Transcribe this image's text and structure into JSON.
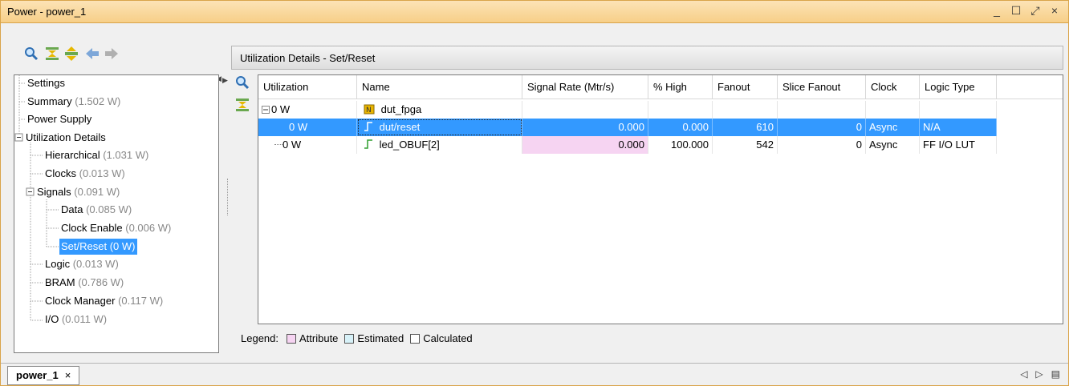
{
  "window": {
    "title": "Power - power_1",
    "minimize_icon": "_",
    "maximize_icon": "☐",
    "restore_icon": "⤢",
    "close_icon": "×"
  },
  "colors": {
    "selection": "#3399ff",
    "attribute": "#f6d4f2",
    "estimated": "#d7f1f8",
    "calculated": "#ffffff",
    "titlebar": "#f9d9a2"
  },
  "left_toolbar": {
    "icons": [
      "search-icon",
      "collapse-all-icon",
      "expand-all-icon",
      "back-arrow-icon",
      "forward-arrow-icon"
    ]
  },
  "tree": [
    {
      "label": "Settings",
      "value": ""
    },
    {
      "label": "Summary",
      "value": "(1.502 W)"
    },
    {
      "label": "Power Supply",
      "value": ""
    },
    {
      "label": "Utilization Details",
      "value": ""
    },
    {
      "label": "Hierarchical",
      "value": "(1.031 W)"
    },
    {
      "label": "Clocks",
      "value": "(0.013 W)"
    },
    {
      "label": "Signals",
      "value": "(0.091 W)"
    },
    {
      "label": "Data",
      "value": "(0.085 W)"
    },
    {
      "label": "Clock Enable",
      "value": "(0.006 W)"
    },
    {
      "label": "Set/Reset",
      "value": "(0 W)"
    },
    {
      "label": "Logic",
      "value": "(0.013 W)"
    },
    {
      "label": "BRAM",
      "value": "(0.786 W)"
    },
    {
      "label": "Clock Manager",
      "value": "(0.117 W)"
    },
    {
      "label": "I/O",
      "value": "(0.011 W)"
    }
  ],
  "panel": {
    "header": "Utilization Details - Set/Reset",
    "columns": [
      "Utilization",
      "Name",
      "Signal Rate (Mtr/s)",
      "% High",
      "Fanout",
      "Slice Fanout",
      "Clock",
      "Logic Type"
    ],
    "rows": [
      {
        "utilization": "0 W",
        "name": "dut_fpga",
        "signal_rate": "",
        "high": "",
        "fanout": "",
        "slice_fanout": "",
        "clock": "",
        "logic_type": ""
      },
      {
        "utilization": "0 W",
        "name": "dut/reset",
        "signal_rate": "0.000",
        "high": "0.000",
        "fanout": "610",
        "slice_fanout": "0",
        "clock": "Async",
        "logic_type": "N/A"
      },
      {
        "utilization": "0 W",
        "name": "led_OBUF[2]",
        "signal_rate": "0.000",
        "high": "100.000",
        "fanout": "542",
        "slice_fanout": "0",
        "clock": "Async",
        "logic_type": "FF I/O LUT"
      }
    ],
    "legend": {
      "label": "Legend:",
      "attribute": "Attribute",
      "estimated": "Estimated",
      "calculated": "Calculated"
    }
  },
  "bottom": {
    "tab_label": "power_1",
    "tab_close": "×",
    "nav_left": "◁",
    "nav_right": "▷",
    "nav_menu": "▤"
  }
}
